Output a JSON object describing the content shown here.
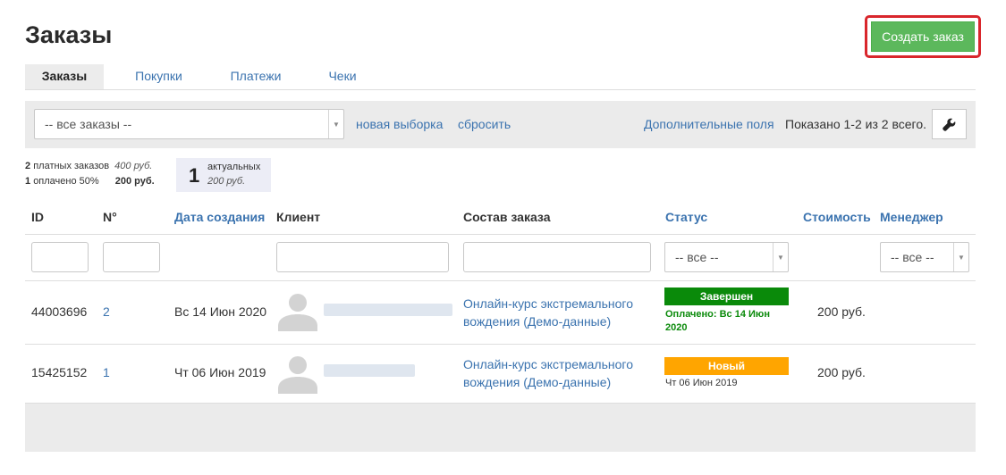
{
  "header": {
    "title": "Заказы",
    "create_button": "Создать заказ",
    "accent_color": "#5cb85c",
    "highlight_color": "#d9262c"
  },
  "tabs": [
    {
      "label": "Заказы",
      "active": true
    },
    {
      "label": "Покупки",
      "active": false
    },
    {
      "label": "Платежи",
      "active": false
    },
    {
      "label": "Чеки",
      "active": false
    }
  ],
  "filter_bar": {
    "select_value": "-- все заказы --",
    "new_selection": "новая выборка",
    "reset": "сбросить",
    "extra_fields": "Дополнительные поля",
    "shown_count": "Показано 1-2 из 2 всего.",
    "settings_icon": "wrench-icon"
  },
  "summary": {
    "paid_count": "2",
    "paid_label": "платных заказов",
    "paid_sum": "400 руб.",
    "paid50_count": "1",
    "paid50_label": "оплачено 50%",
    "paid50_sum": "200 руб.",
    "actual_count": "1",
    "actual_label": "актуальных",
    "actual_sum": "200 руб."
  },
  "table": {
    "columns": {
      "id": "ID",
      "num": "N°",
      "created": "Дата создания",
      "client": "Клиент",
      "composition": "Состав заказа",
      "status": "Статус",
      "cost": "Стоимость",
      "manager": "Менеджер"
    },
    "filters": {
      "status_select": "-- все --",
      "manager_select": "-- все --"
    },
    "rows": [
      {
        "id": "44003696",
        "num": "2",
        "created": "Вс 14 Июн 2020",
        "composition": "Онлайн-курс экстремального вождения (Демо-данные)",
        "status": "Завершен",
        "status_color": "#0a8a0a",
        "status_note": "Оплачено: Вс 14 Июн 2020",
        "cost": "200 руб."
      },
      {
        "id": "15425152",
        "num": "1",
        "created": "Чт 06 Июн 2019",
        "composition": "Онлайн-курс экстремального вождения (Демо-данные)",
        "status": "Новый",
        "status_color": "#ffa500",
        "status_note": "Чт 06 Июн 2019",
        "cost": "200 руб."
      }
    ]
  }
}
